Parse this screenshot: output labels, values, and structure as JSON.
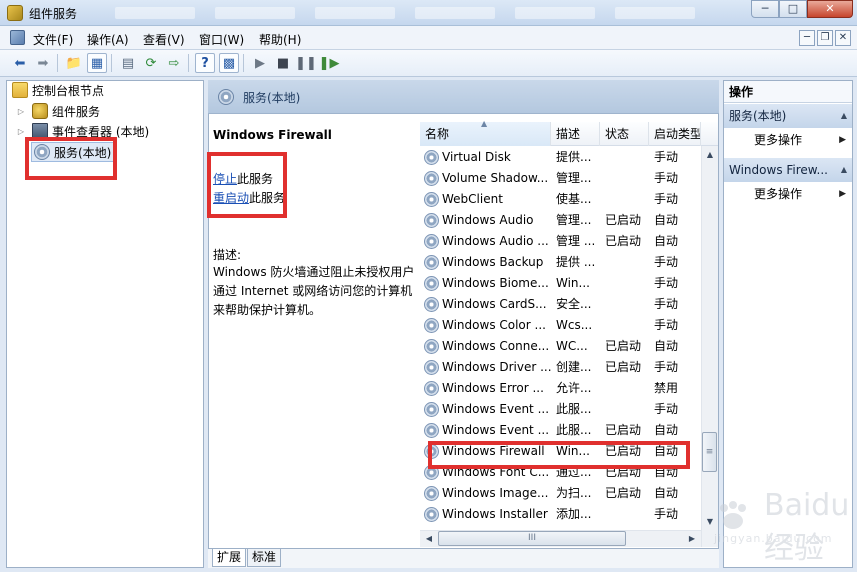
{
  "window": {
    "title": "组件服务",
    "min_glyph": "─",
    "max_glyph": "□",
    "close_glyph": "✕"
  },
  "menu": [
    "文件(F)",
    "操作(A)",
    "查看(V)",
    "窗口(W)",
    "帮助(H)"
  ],
  "mdi": {
    "min": "─",
    "restore": "❐",
    "close": "✕"
  },
  "toolbar_icons": [
    "back-arrow-icon",
    "forward-arrow-icon",
    "up-folder-icon",
    "show-tree-icon",
    "properties-icon",
    "refresh-icon",
    "export-icon",
    "help-icon",
    "console-icon",
    "play-icon",
    "stop-icon",
    "pause-icon",
    "restart-icon"
  ],
  "tree": {
    "root": "控制台根节点",
    "items": [
      "组件服务",
      "事件查看器 (本地)",
      "服务(本地)"
    ],
    "expand_glyph": "▷"
  },
  "mid": {
    "header": "服务(本地)",
    "service_name": "Windows Firewall",
    "stop_link": "停止",
    "stop_suffix": "此服务",
    "restart_link": "重启动",
    "restart_suffix": "此服务",
    "desc_label": "描述:",
    "desc_text": "Windows 防火墙通过阻止未授权用户通过 Internet 或网络访问您的计算机来帮助保护计算机。"
  },
  "list": {
    "columns": [
      "名称",
      "描述",
      "状态",
      "启动类型"
    ],
    "sort_glyph": "▲",
    "rows": [
      [
        "Virtual Disk",
        "提供...",
        "",
        "手动"
      ],
      [
        "Volume Shadow...",
        "管理...",
        "",
        "手动"
      ],
      [
        "WebClient",
        "使基...",
        "",
        "手动"
      ],
      [
        "Windows Audio",
        "管理...",
        "已启动",
        "自动"
      ],
      [
        "Windows Audio ...",
        "管理 ...",
        "已启动",
        "自动"
      ],
      [
        "Windows Backup",
        "提供 ...",
        "",
        "手动"
      ],
      [
        "Windows Biome...",
        "Win...",
        "",
        "手动"
      ],
      [
        "Windows CardS...",
        "安全...",
        "",
        "手动"
      ],
      [
        "Windows Color ...",
        "Wcs...",
        "",
        "手动"
      ],
      [
        "Windows Conne...",
        "WC...",
        "已启动",
        "自动"
      ],
      [
        "Windows Driver ...",
        "创建...",
        "已启动",
        "手动"
      ],
      [
        "Windows Error ...",
        "允许...",
        "",
        "禁用"
      ],
      [
        "Windows Event ...",
        "此服...",
        "",
        "手动"
      ],
      [
        "Windows Event ...",
        "此服...",
        "已启动",
        "自动"
      ],
      [
        "Windows Firewall",
        "Win...",
        "已启动",
        "自动"
      ],
      [
        "Windows Font C...",
        "通过...",
        "已启动",
        "自动"
      ],
      [
        "Windows Image...",
        "为扫...",
        "已启动",
        "自动"
      ],
      [
        "Windows Installer",
        "添加...",
        "",
        "手动"
      ]
    ],
    "scroll": {
      "up": "▲",
      "down": "▼",
      "left": "◀",
      "right": "▶",
      "grip": "III",
      "vgrip": "≡"
    }
  },
  "tabs": [
    "扩展",
    "标准"
  ],
  "actions": {
    "title": "操作",
    "sections": [
      {
        "label": "服务(本地)",
        "item": "更多操作"
      },
      {
        "label": "Windows Firew...",
        "item": "更多操作"
      }
    ],
    "tri": "▲",
    "arrow": "▶"
  },
  "watermark": {
    "brand": "Baidu 经验",
    "url": "jingyan.baidu.com"
  },
  "colors": {
    "highlight": "#e0302e",
    "link": "#1a4fb5",
    "header": "#b4c8df"
  }
}
